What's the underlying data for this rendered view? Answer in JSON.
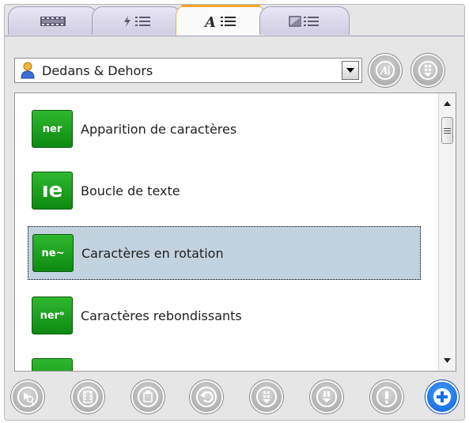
{
  "tabs": [
    {
      "name": "filmstrip-tab",
      "icon": "filmstrip-icon"
    },
    {
      "name": "transitions-tab",
      "icon": "lightning-list-icon"
    },
    {
      "name": "text-effects-tab",
      "icon": "text-list-icon",
      "active": true
    },
    {
      "name": "filters-tab",
      "icon": "image-list-icon"
    }
  ],
  "toolbar": {
    "category_selected": "Dedans & Dehors",
    "category_icon": "person-icon"
  },
  "effects_list": {
    "items": [
      {
        "label": "Apparition de caractères",
        "thumb_text": "ner",
        "selected": false
      },
      {
        "label": "Boucle de texte",
        "thumb_text": "ıe",
        "selected": false
      },
      {
        "label": "Caractères en rotation",
        "thumb_text": "ne~",
        "selected": true
      },
      {
        "label": "Caractères rebondissants",
        "thumb_text": "nerᵒ",
        "selected": false
      },
      {
        "label": "",
        "thumb_text": "",
        "selected": false
      }
    ]
  },
  "colors": {
    "accent_tab": "#f0a72c",
    "selection": "#c2d2de",
    "thumb_green": "#1aa11f",
    "primary_button": "#0a6fe8"
  }
}
